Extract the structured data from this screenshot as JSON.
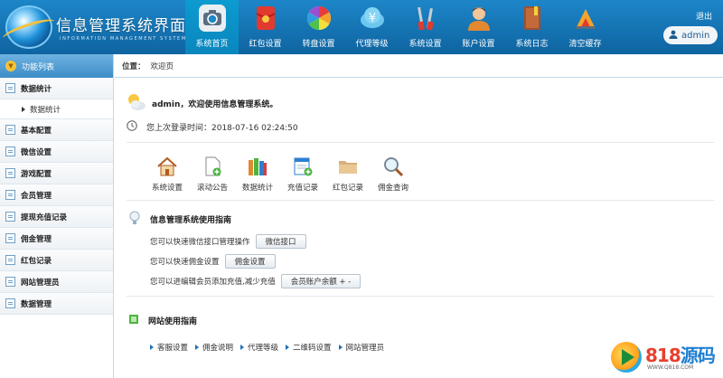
{
  "header": {
    "title": "信息管理系统界面",
    "subtitle": "INFORMATION MANAGEMENT SYSTEM GUI",
    "logout": "退出",
    "user": "admin"
  },
  "nav": [
    {
      "label": "系统首页",
      "icon": "camera-icon",
      "active": true
    },
    {
      "label": "红包设置",
      "icon": "red-envelope-icon",
      "active": false
    },
    {
      "label": "转盘设置",
      "icon": "color-wheel-icon",
      "active": false
    },
    {
      "label": "代理等级",
      "icon": "yen-cloud-icon",
      "active": false
    },
    {
      "label": "系统设置",
      "icon": "tools-icon",
      "active": false
    },
    {
      "label": "账户设置",
      "icon": "user-icon",
      "active": false
    },
    {
      "label": "系统日志",
      "icon": "book-icon",
      "active": false
    },
    {
      "label": "清空缓存",
      "icon": "broom-icon",
      "active": false
    }
  ],
  "sidebar": {
    "header": "功能列表",
    "items": [
      {
        "label": "数据统计"
      },
      {
        "label": "数据统计",
        "sub": true
      },
      {
        "label": "基本配置"
      },
      {
        "label": "微信设置"
      },
      {
        "label": "游戏配置"
      },
      {
        "label": "会员管理"
      },
      {
        "label": "提现充值记录"
      },
      {
        "label": "佣金管理"
      },
      {
        "label": "红包记录"
      },
      {
        "label": "网站管理员"
      },
      {
        "label": "数据管理"
      }
    ]
  },
  "breadcrumb": {
    "label": "位置：",
    "current": "欢迎页"
  },
  "welcome": {
    "message": "admin，欢迎使用信息管理系统。",
    "last_login": "您上次登录时间：2018-07-16 02:24:50"
  },
  "quick": [
    {
      "label": "系统设置",
      "icon": "house-icon"
    },
    {
      "label": "滚动公告",
      "icon": "document-add-icon"
    },
    {
      "label": "数据统计",
      "icon": "books-icon"
    },
    {
      "label": "充值记录",
      "icon": "list-add-icon"
    },
    {
      "label": "红包记录",
      "icon": "folder-icon"
    },
    {
      "label": "佣金查询",
      "icon": "magnifier-icon"
    }
  ],
  "guide": {
    "title": "信息管理系统使用指南",
    "rows": [
      {
        "text": "您可以快速微信接口管理操作",
        "button": "微信接口"
      },
      {
        "text": "您可以快速佣金设置",
        "button": "佣金设置"
      },
      {
        "text": "您可以进编辑会员添加充值,减少充值",
        "button": "会员账户余额 + -"
      }
    ]
  },
  "site_guide": {
    "title": "网站使用指南",
    "links": [
      "客服设置",
      "佣金说明",
      "代理等级",
      "二维码设置",
      "网站管理员"
    ]
  },
  "watermark": {
    "brand_num": "818",
    "brand_text": "源码",
    "url": "WWW.Q818.COM"
  }
}
